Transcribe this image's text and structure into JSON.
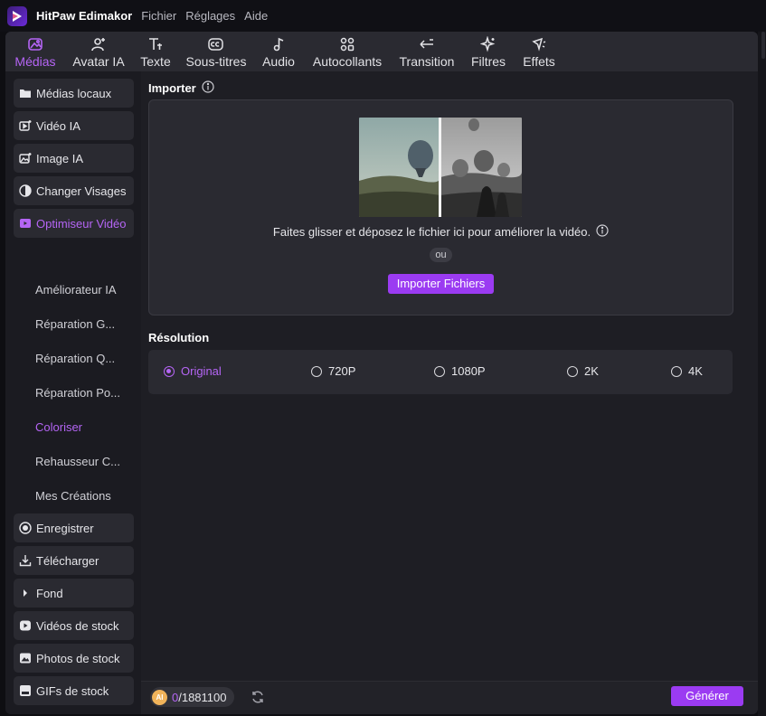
{
  "app": {
    "name": "HitPaw Edimakor"
  },
  "menu": [
    "Fichier",
    "Réglages",
    "Aide"
  ],
  "toolbar": [
    {
      "label": "Médias",
      "icon": "media-icon",
      "active": true
    },
    {
      "label": "Avatar IA",
      "icon": "avatar-icon",
      "active": false
    },
    {
      "label": "Texte",
      "icon": "text-icon",
      "active": false
    },
    {
      "label": "Sous-titres",
      "icon": "subtitles-icon",
      "active": false
    },
    {
      "label": "Audio",
      "icon": "music-note-icon",
      "active": false
    },
    {
      "label": "Autocollants",
      "icon": "stickers-icon",
      "active": false
    },
    {
      "label": "Transition",
      "icon": "transition-icon",
      "active": false
    },
    {
      "label": "Filtres",
      "icon": "sparkle-icon",
      "active": false
    },
    {
      "label": "Effets",
      "icon": "effects-icon",
      "active": false
    }
  ],
  "sidebar": {
    "top": [
      {
        "label": "Médias locaux",
        "icon": "folder-icon"
      },
      {
        "label": "Vidéo IA",
        "icon": "video-ai-icon"
      },
      {
        "label": "Image IA",
        "icon": "image-ai-icon"
      },
      {
        "label": "Changer Visages",
        "icon": "face-swap-icon"
      },
      {
        "label": "Optimiseur Vidéo",
        "icon": "video-enhancer-icon",
        "active": true
      }
    ],
    "sub": [
      {
        "label": "Améliorateur IA"
      },
      {
        "label": "Réparation G..."
      },
      {
        "label": "Réparation Q..."
      },
      {
        "label": "Réparation Po..."
      },
      {
        "label": "Coloriser",
        "active": true
      },
      {
        "label": "Rehausseur C..."
      },
      {
        "label": "Mes Créations"
      }
    ],
    "bottom": [
      {
        "label": "Enregistrer",
        "icon": "record-icon"
      },
      {
        "label": "Télécharger",
        "icon": "download-icon"
      },
      {
        "label": "Fond",
        "icon": "caret-right-icon"
      },
      {
        "label": "Vidéos de stock",
        "icon": "play-icon"
      },
      {
        "label": "Photos de stock",
        "icon": "photo-icon"
      },
      {
        "label": "GIFs de stock",
        "icon": "gif-icon"
      }
    ]
  },
  "import": {
    "title": "Importer",
    "drop_text": "Faites glisser et déposez le fichier ici pour améliorer la vidéo.",
    "or": "ou",
    "button": "Importer Fichiers"
  },
  "resolution": {
    "title": "Résolution",
    "options": [
      {
        "label": "Original",
        "checked": true
      },
      {
        "label": "720P",
        "checked": false
      },
      {
        "label": "1080P",
        "checked": false
      },
      {
        "label": "2K",
        "checked": false
      },
      {
        "label": "4K",
        "checked": false
      }
    ]
  },
  "credits": {
    "coin_label": "AI",
    "used": "0",
    "total": "/1881100"
  },
  "generate": {
    "label": "Générer"
  },
  "colors": {
    "accent": "#9b3bf2",
    "accent_text": "#b565f5",
    "panel": "#2a2a31",
    "background": "#1b1b21"
  }
}
